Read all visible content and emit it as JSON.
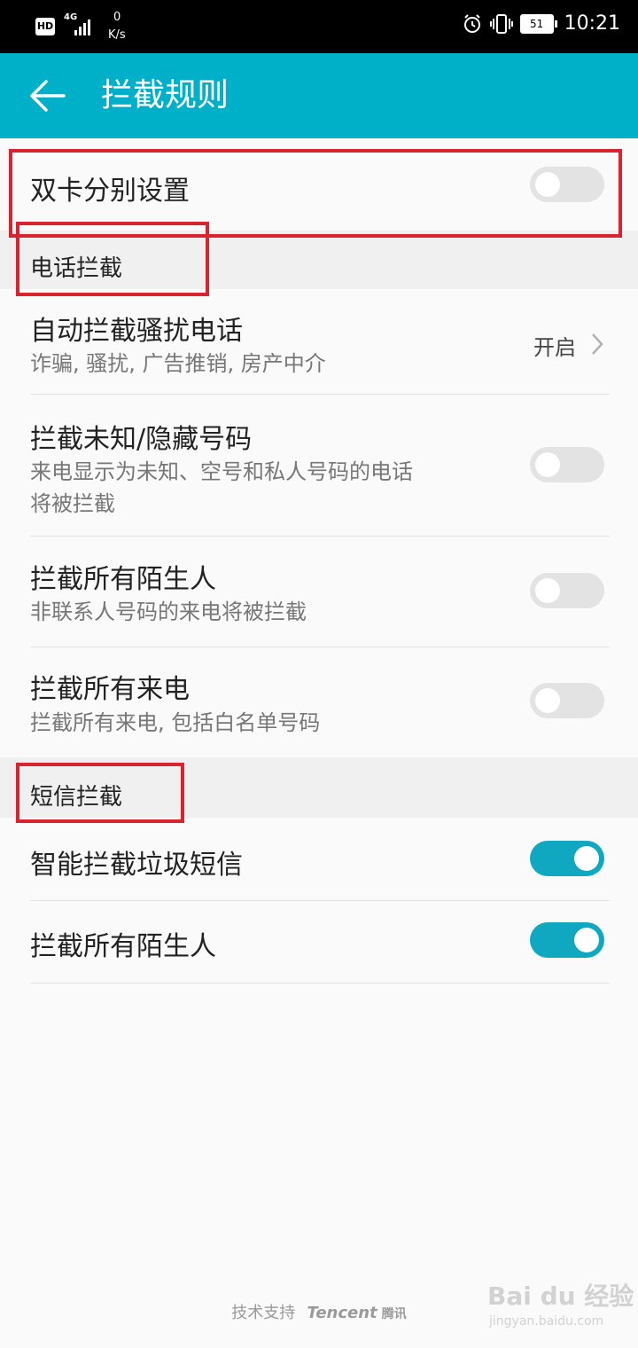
{
  "status_bar": {
    "hd": "HD",
    "network": "4G",
    "speed_value": "0",
    "speed_unit": "K/s",
    "battery": "51",
    "time": "10:21"
  },
  "app_bar": {
    "title": "拦截规则"
  },
  "dual_sim": {
    "title": "双卡分别设置",
    "enabled": false
  },
  "phone_section": {
    "header": "电话拦截",
    "items": [
      {
        "title": "自动拦截骚扰电话",
        "subtitle": "诈骗, 骚扰, 广告推销, 房产中介",
        "value": "开启"
      },
      {
        "title": "拦截未知/隐藏号码",
        "subtitle1": "来电显示为未知、空号和私人号码的电话",
        "subtitle2": "将被拦截",
        "enabled": false
      },
      {
        "title": "拦截所有陌生人",
        "subtitle": "非联系人号码的来电将被拦截",
        "enabled": false
      },
      {
        "title": "拦截所有来电",
        "subtitle": "拦截所有来电, 包括白名单号码",
        "enabled": false
      }
    ]
  },
  "sms_section": {
    "header": "短信拦截",
    "items": [
      {
        "title": "智能拦截垃圾短信",
        "enabled": true
      },
      {
        "title": "拦截所有陌生人",
        "enabled": true
      }
    ]
  },
  "footer": {
    "prefix": "技术支持",
    "brand": "Tencent",
    "brand_cn": "腾讯"
  },
  "watermark": {
    "text": "Bai du 经验",
    "url": "jingyan.baidu.com"
  },
  "colors": {
    "accent": "#00afc8",
    "toggle_on": "#0fa8c0",
    "highlight_box": "#d9232f"
  }
}
